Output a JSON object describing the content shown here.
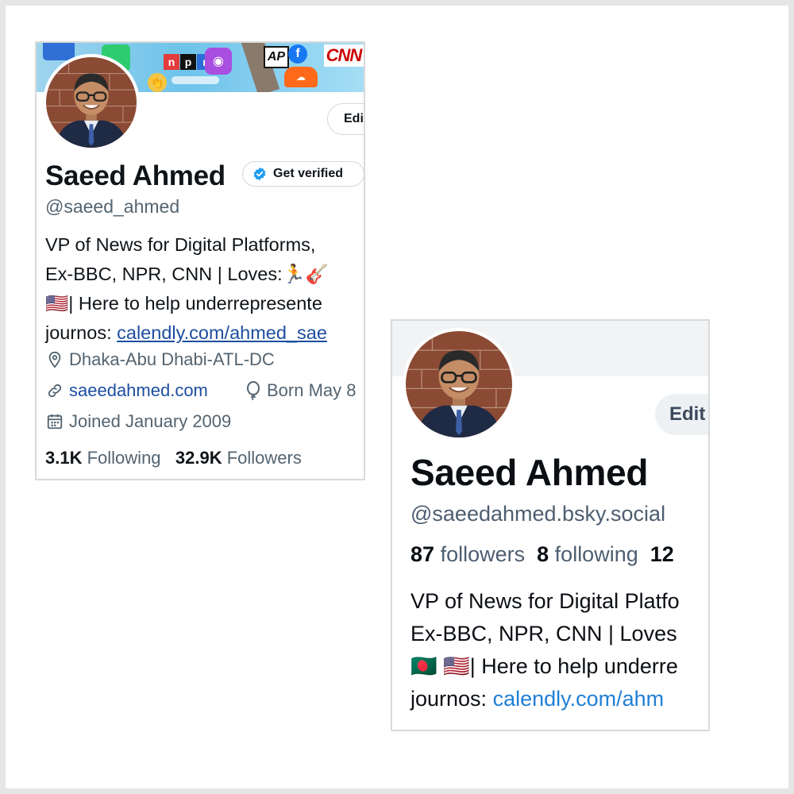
{
  "x_profile": {
    "banner_logos": {
      "npr": "npr",
      "ap": "AP",
      "cnn": "CNN"
    },
    "edit_button": "Edi",
    "name": "Saeed Ahmed",
    "get_verified": "Get verified",
    "handle": "@saeed_ahmed",
    "bio": {
      "line1": "VP of News for Digital Platforms,",
      "line2": "Ex-BBC, NPR, CNN | Loves:🏃🎸",
      "line3_flag": "🇺🇸",
      "line3_text": "| Here to help underrepresente",
      "line4_prefix": "journos: ",
      "line4_link": "calendly.com/ahmed_sae"
    },
    "location": "Dhaka-Abu Dhabi-ATL-DC",
    "website": "saeedahmed.com",
    "born": "Born May 8",
    "joined": "Joined January 2009",
    "following_count": "3.1K",
    "following_label": "Following",
    "followers_count": "32.9K",
    "followers_label": "Followers",
    "icons": [
      "location-pin-icon",
      "link-icon",
      "balloon-icon",
      "calendar-icon",
      "verified-badge-icon"
    ],
    "colors": {
      "verified_blue": "#1d9bf0",
      "link_blue": "#1d4ea0",
      "muted": "#536471"
    }
  },
  "bluesky_profile": {
    "edit_button": "Edit",
    "name": "Saeed Ahmed",
    "handle": "@saeedahmed.bsky.social",
    "followers_count": "87",
    "followers_label": "followers",
    "following_count": "8",
    "following_label": "following",
    "posts_count": "12",
    "bio": {
      "line1": "VP of News for Digital Platfo",
      "line2": "Ex-BBC, NPR, CNN | Loves",
      "line3_flags": "🇧🇩 🇺🇸",
      "line3_text": "| Here to help underre",
      "line4_prefix": "journos: ",
      "line4_link": "calendly.com/ahm"
    },
    "colors": {
      "link_blue": "#1f7fd6",
      "muted": "#4d5e70"
    }
  }
}
